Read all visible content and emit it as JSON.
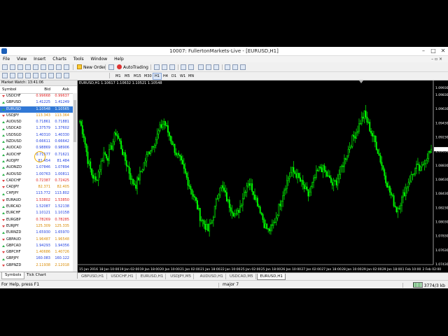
{
  "window": {
    "title": "10007: FullertonMarkets-Live - [EURUSD,H1]",
    "controls": [
      "–",
      "□",
      "✕"
    ]
  },
  "menu": [
    "File",
    "View",
    "Insert",
    "Charts",
    "Tools",
    "Window",
    "Help"
  ],
  "toolbar": {
    "new_order": "New Order",
    "auto_trading": "AutoTrading",
    "timeframes": [
      "M1",
      "M5",
      "M15",
      "M30",
      "H1",
      "H4",
      "D1",
      "W1",
      "MN"
    ],
    "active_timeframe": "H1"
  },
  "market_watch": {
    "header": "Market Watch: 13:41:06",
    "columns": [
      "Symbol",
      "Bid",
      "Ask"
    ],
    "rows": [
      {
        "symbol": "USDCHF",
        "bid": "0.99668",
        "ask": "0.99637",
        "dir": "down",
        "color": "red"
      },
      {
        "symbol": "GBPUSD",
        "bid": "1.41225",
        "ask": "1.41249",
        "dir": "up",
        "color": "blue"
      },
      {
        "symbol": "EURUSD",
        "bid": "1.10548",
        "ask": "1.10565",
        "dir": "up",
        "color": "blue",
        "selected": true
      },
      {
        "symbol": "USDJPY",
        "bid": "113.343",
        "ask": "113.364",
        "dir": "down",
        "color": "orange"
      },
      {
        "symbol": "AUDUSD",
        "bid": "0.71861",
        "ask": "0.71881",
        "dir": "up",
        "color": "blue"
      },
      {
        "symbol": "USDCAD",
        "bid": "1.37579",
        "ask": "1.37602",
        "dir": "up",
        "color": "blue"
      },
      {
        "symbol": "USDSGD",
        "bid": "1.40310",
        "ask": "1.40330",
        "dir": "up",
        "color": "blue"
      },
      {
        "symbol": "NZDUSD",
        "bid": "0.66611",
        "ask": "0.66642",
        "dir": "up",
        "color": "blue"
      },
      {
        "symbol": "AUDCAD",
        "bid": "0.98869",
        "ask": "0.98906",
        "dir": "up",
        "color": "blue"
      },
      {
        "symbol": "AUDCHF",
        "bid": "0.71577",
        "ask": "0.71621",
        "dir": "up",
        "color": "blue"
      },
      {
        "symbol": "AUDJPY",
        "bid": "81.454",
        "ask": "81.484",
        "dir": "up",
        "color": "blue"
      },
      {
        "symbol": "AUDNZD",
        "bid": "1.07846",
        "ask": "1.07894",
        "dir": "up",
        "color": "blue"
      },
      {
        "symbol": "AUDUSD",
        "bid": "1.00763",
        "ask": "1.00811",
        "dir": "up",
        "color": "blue"
      },
      {
        "symbol": "CADCHF",
        "bid": "0.72387",
        "ask": "0.72425",
        "dir": "down",
        "color": "red"
      },
      {
        "symbol": "CADJPY",
        "bid": "82.371",
        "ask": "82.405",
        "dir": "down",
        "color": "orange"
      },
      {
        "symbol": "CHFJPY",
        "bid": "113.772",
        "ask": "113.802",
        "dir": "up",
        "color": "blue"
      },
      {
        "symbol": "EURAUD",
        "bid": "1.53802",
        "ask": "1.53850",
        "dir": "down",
        "color": "red"
      },
      {
        "symbol": "EURCAD",
        "bid": "1.52087",
        "ask": "1.52138",
        "dir": "up",
        "color": "blue"
      },
      {
        "symbol": "EURCHF",
        "bid": "1.10121",
        "ask": "1.10158",
        "dir": "up",
        "color": "blue"
      },
      {
        "symbol": "EURGBP",
        "bid": "0.78269",
        "ask": "0.78285",
        "dir": "down",
        "color": "red"
      },
      {
        "symbol": "EURJPY",
        "bid": "125.309",
        "ask": "125.335",
        "dir": "down",
        "color": "orange"
      },
      {
        "symbol": "EURNZD",
        "bid": "1.65930",
        "ask": "1.65970",
        "dir": "up",
        "color": "blue"
      },
      {
        "symbol": "GBPAUD",
        "bid": "1.96487",
        "ask": "1.96548",
        "dir": "down",
        "color": "orange"
      },
      {
        "symbol": "GBPCAD",
        "bid": "1.94293",
        "ask": "1.94356",
        "dir": "up",
        "color": "blue"
      },
      {
        "symbol": "GBPCHF",
        "bid": "1.40686",
        "ask": "1.40726",
        "dir": "down",
        "color": "orange"
      },
      {
        "symbol": "GBPJPY",
        "bid": "160.083",
        "ask": "160.122",
        "dir": "up",
        "color": "blue"
      },
      {
        "symbol": "GBPNZD",
        "bid": "2.11938",
        "ask": "2.12018",
        "dir": "down",
        "color": "orange"
      }
    ],
    "tabs": [
      "Symbols",
      "Tick Chart"
    ],
    "active_tab": "Symbols"
  },
  "chart": {
    "label": "EURUSD,H1  1.10617 1.10632 1.10521 1.10548",
    "price_labels": [
      "1.09930",
      "1.09830",
      "1.09630",
      "1.09430",
      "1.09230",
      "1.09030",
      "1.08830",
      "1.08630",
      "1.08430",
      "1.08230",
      "1.08030",
      "1.07830",
      "1.07630",
      "1.07430"
    ],
    "time_labels": [
      "15 Jan 2016",
      "18 Jan 10:00",
      "19 Jan 02:00",
      "19 Jan 18:00",
      "20 Jan 10:00",
      "21 Jan 02:00",
      "21 Jan 18:00",
      "22 Jan 10:00",
      "25 Jan 02:00",
      "25 Jan 18:00",
      "26 Jan 10:00",
      "27 Jan 02:00",
      "27 Jan 18:00",
      "28 Jan 10:00",
      "29 Jan 02:00",
      "29 Jan 18:00",
      "1 Feb 10:00",
      "2 Feb 02:00"
    ],
    "candle_color": "#00ff00",
    "closes": [
      1.0945,
      1.0925,
      1.089,
      1.087,
      1.086,
      1.088,
      1.09,
      1.0895,
      1.091,
      1.093,
      1.0915,
      1.0895,
      1.088,
      1.086,
      1.0855,
      1.087,
      1.0885,
      1.09,
      1.091,
      1.092,
      1.0935,
      1.0945,
      1.093,
      1.0915,
      1.09,
      1.089,
      1.0875,
      1.086,
      1.0845,
      1.083,
      1.081,
      1.08,
      1.079,
      1.0805,
      1.083,
      1.0855,
      1.0845,
      1.083,
      1.082,
      1.081,
      1.0825,
      1.0845,
      1.086,
      1.085,
      1.0835,
      1.082,
      1.08,
      1.079,
      1.0795,
      1.081,
      1.083,
      1.085,
      1.0865,
      1.0875,
      1.087,
      1.086,
      1.085,
      1.084,
      1.0855,
      1.087,
      1.088,
      1.0875,
      1.0865,
      1.0855,
      1.086,
      1.0875,
      1.089,
      1.0905,
      1.092,
      1.093,
      1.0945,
      1.0955,
      1.094,
      1.0925,
      1.091,
      1.089,
      1.087,
      1.085,
      1.0835,
      1.082,
      1.083,
      1.0845,
      1.086,
      1.087,
      1.088,
      1.0875,
      1.089,
      1.09
    ]
  },
  "chart_tabs": [
    "GBPUSD,H1",
    "USDCHF,H1",
    "EURUSD,H1",
    "USDJPY,M5",
    "AUDUSD,H1",
    "USDCAD,M5",
    "EURUSD,H1"
  ],
  "active_chart_tab": 6,
  "status": {
    "help": "For Help, press F1",
    "profile": "major 7",
    "traffic": "3774/3 kb"
  }
}
